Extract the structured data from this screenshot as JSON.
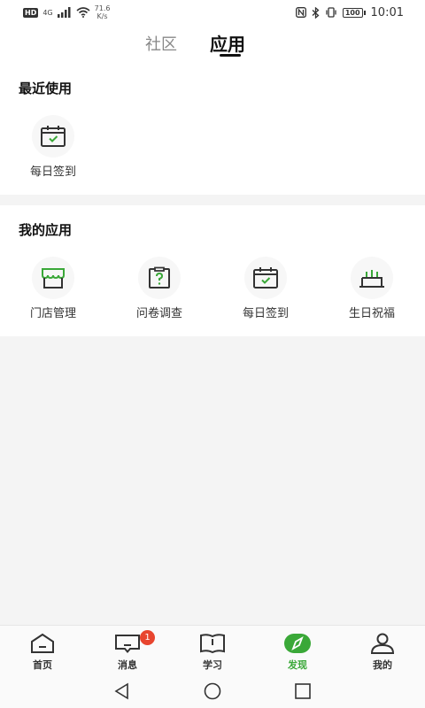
{
  "status_bar": {
    "hd": "HD",
    "network": "4G",
    "speed_value": "71.6",
    "speed_unit": "K/s",
    "battery": "100",
    "time": "10:01"
  },
  "top_tabs": [
    {
      "label": "社区",
      "active": false
    },
    {
      "label": "应用",
      "active": true
    }
  ],
  "recent": {
    "title": "最近使用",
    "apps": [
      {
        "label": "每日签到",
        "icon": "calendar-check-icon"
      }
    ]
  },
  "my_apps": {
    "title": "我的应用",
    "apps": [
      {
        "label": "门店管理",
        "icon": "store-icon"
      },
      {
        "label": "问卷调查",
        "icon": "questionnaire-icon"
      },
      {
        "label": "每日签到",
        "icon": "calendar-check-icon"
      },
      {
        "label": "生日祝福",
        "icon": "birthday-cake-icon"
      }
    ]
  },
  "bottom_nav": [
    {
      "label": "首页",
      "icon": "home-icon",
      "active": false
    },
    {
      "label": "消息",
      "icon": "message-icon",
      "active": false,
      "badge": "1"
    },
    {
      "label": "学习",
      "icon": "book-icon",
      "active": false
    },
    {
      "label": "发现",
      "icon": "compass-icon",
      "active": true
    },
    {
      "label": "我的",
      "icon": "user-icon",
      "active": false
    }
  ],
  "system_nav": [
    "back-icon",
    "home-circle-icon",
    "recents-icon"
  ],
  "colors": {
    "accent": "#3aa838",
    "badge": "#e8452f",
    "background": "#f4f4f4"
  }
}
